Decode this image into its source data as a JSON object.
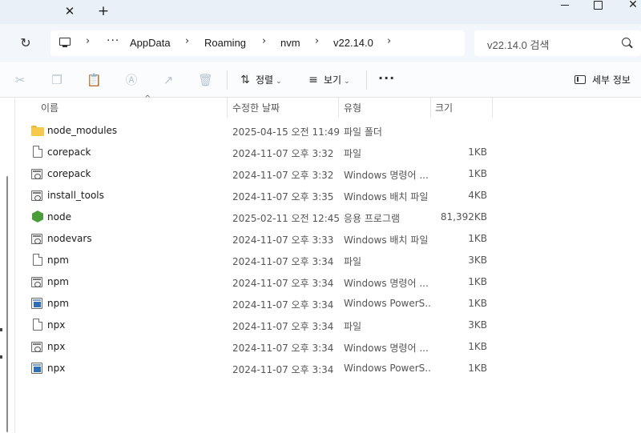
{
  "titlebar": {
    "tab_close_glyph": "✕",
    "new_tab_glyph": "+",
    "close_glyph": "✕"
  },
  "address": {
    "breadcrumb": [
      "AppData",
      "Roaming",
      "nvm",
      "v22.14.0"
    ],
    "more_glyph": "···",
    "separator_glyph": "›",
    "refresh_glyph": "↻"
  },
  "search": {
    "placeholder": "v22.14.0 검색"
  },
  "commandbar": {
    "icons": [
      "cut-icon",
      "copy-icon",
      "paste-icon",
      "rename-icon",
      "share-icon",
      "delete-icon"
    ],
    "icon_glyphs": [
      "✂",
      "❐",
      "📋",
      "Ⓐ",
      "↗",
      "🗑"
    ],
    "sort_label": "정렬",
    "sort_glyph": "⇅",
    "view_label": "보기",
    "view_glyph": "≡",
    "chevron_glyph": "⌄",
    "more_glyph": "···",
    "details_label": "세부 정보"
  },
  "columns": {
    "name": "이름",
    "date": "수정한 날짜",
    "type": "유형",
    "size": "크기",
    "sort_arrow": "^"
  },
  "files": [
    {
      "icon": "folder-icon",
      "name": "node_modules",
      "date": "2025-04-15 오전 11:49",
      "type": "파일 폴더",
      "size": ""
    },
    {
      "icon": "file-icon",
      "name": "corepack",
      "date": "2024-11-07 오후 3:32",
      "type": "파일",
      "size": "1KB"
    },
    {
      "icon": "batch-file-icon",
      "name": "corepack",
      "date": "2024-11-07 오후 3:32",
      "type": "Windows 명령어 ...",
      "size": "1KB"
    },
    {
      "icon": "batch-file-icon",
      "name": "install_tools",
      "date": "2024-11-07 오후 3:35",
      "type": "Windows 배치 파일",
      "size": "4KB"
    },
    {
      "icon": "nodejs-icon",
      "name": "node",
      "date": "2025-02-11 오전 12:45",
      "type": "응용 프로그램",
      "size": "81,392KB"
    },
    {
      "icon": "batch-file-icon",
      "name": "nodevars",
      "date": "2024-11-07 오후 3:33",
      "type": "Windows 배치 파일",
      "size": "1KB"
    },
    {
      "icon": "file-icon",
      "name": "npm",
      "date": "2024-11-07 오후 3:34",
      "type": "파일",
      "size": "3KB"
    },
    {
      "icon": "batch-file-icon",
      "name": "npm",
      "date": "2024-11-07 오후 3:34",
      "type": "Windows 명령어 ...",
      "size": "1KB"
    },
    {
      "icon": "powershell-script-icon",
      "name": "npm",
      "date": "2024-11-07 오후 3:34",
      "type": "Windows PowerS...",
      "size": "1KB"
    },
    {
      "icon": "file-icon",
      "name": "npx",
      "date": "2024-11-07 오후 3:34",
      "type": "파일",
      "size": "3KB"
    },
    {
      "icon": "batch-file-icon",
      "name": "npx",
      "date": "2024-11-07 오후 3:34",
      "type": "Windows 명령어 ...",
      "size": "1KB"
    },
    {
      "icon": "powershell-script-icon",
      "name": "npx",
      "date": "2024-11-07 오후 3:34",
      "type": "Windows PowerS...",
      "size": "1KB"
    }
  ]
}
